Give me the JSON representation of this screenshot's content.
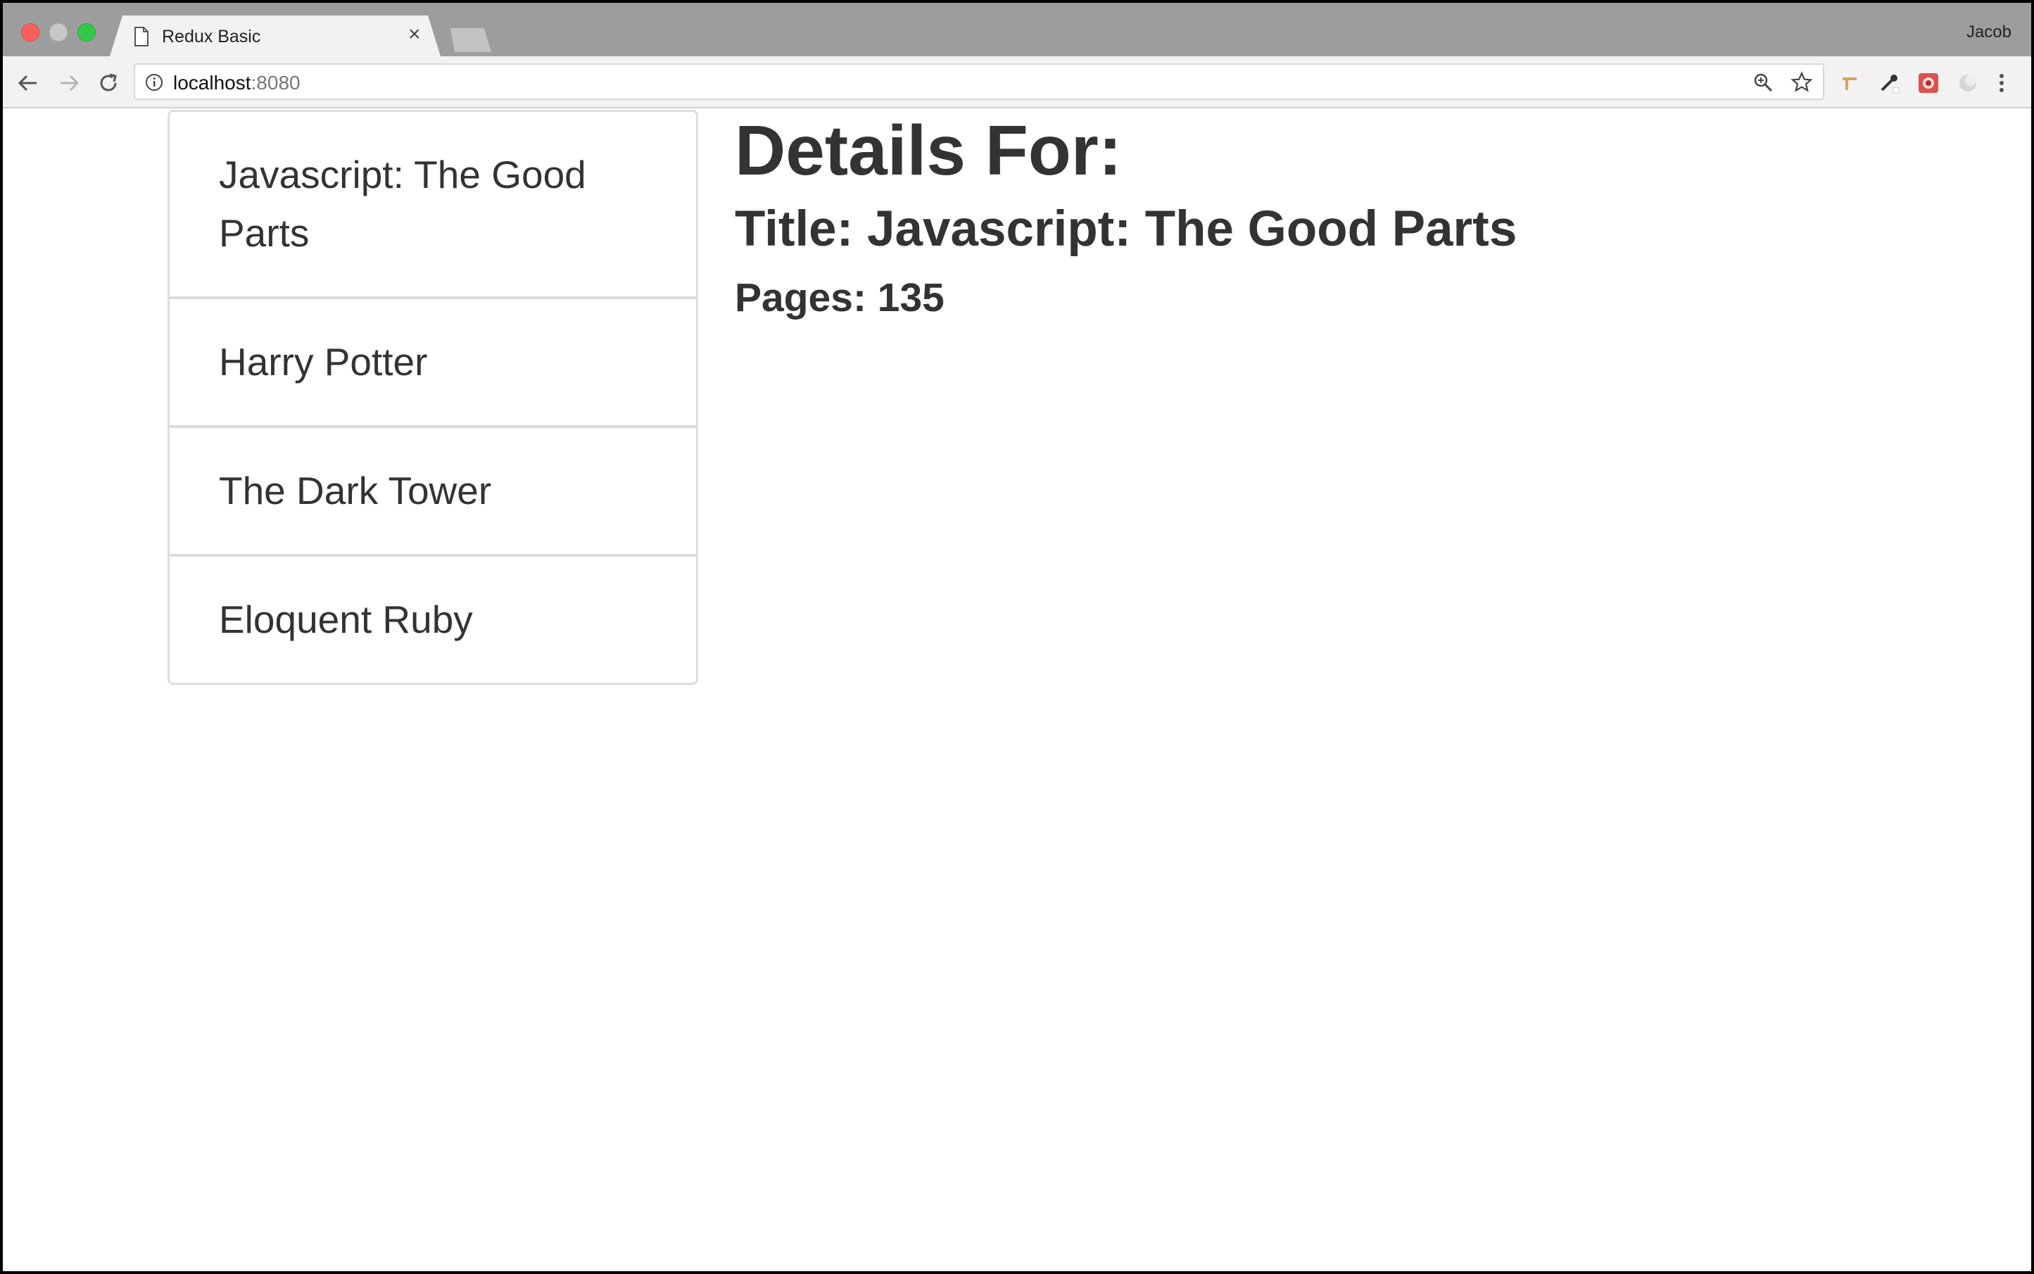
{
  "browser": {
    "tab_title": "Redux Basic",
    "tab_close": "×",
    "profile_name": "Jacob",
    "url_host": "localhost",
    "url_port": ":8080"
  },
  "icons": {
    "back": "back-arrow-icon",
    "forward": "forward-arrow-icon",
    "reload": "reload-icon",
    "info": "info-icon",
    "zoom": "zoom-icon",
    "bookmark": "star-icon",
    "menu": "kebab-menu-icon"
  },
  "books": [
    {
      "title": "Javascript: The Good Parts"
    },
    {
      "title": "Harry Potter"
    },
    {
      "title": "The Dark Tower"
    },
    {
      "title": "Eloquent Ruby"
    }
  ],
  "details": {
    "heading": "Details For:",
    "title_line": "Title: Javascript: The Good Parts",
    "pages_line": "Pages: 135"
  },
  "colors": {
    "text": "#333333",
    "list_border": "#dddddd",
    "tabstrip": "#9d9d9d",
    "toolbar": "#f2f2f2"
  }
}
